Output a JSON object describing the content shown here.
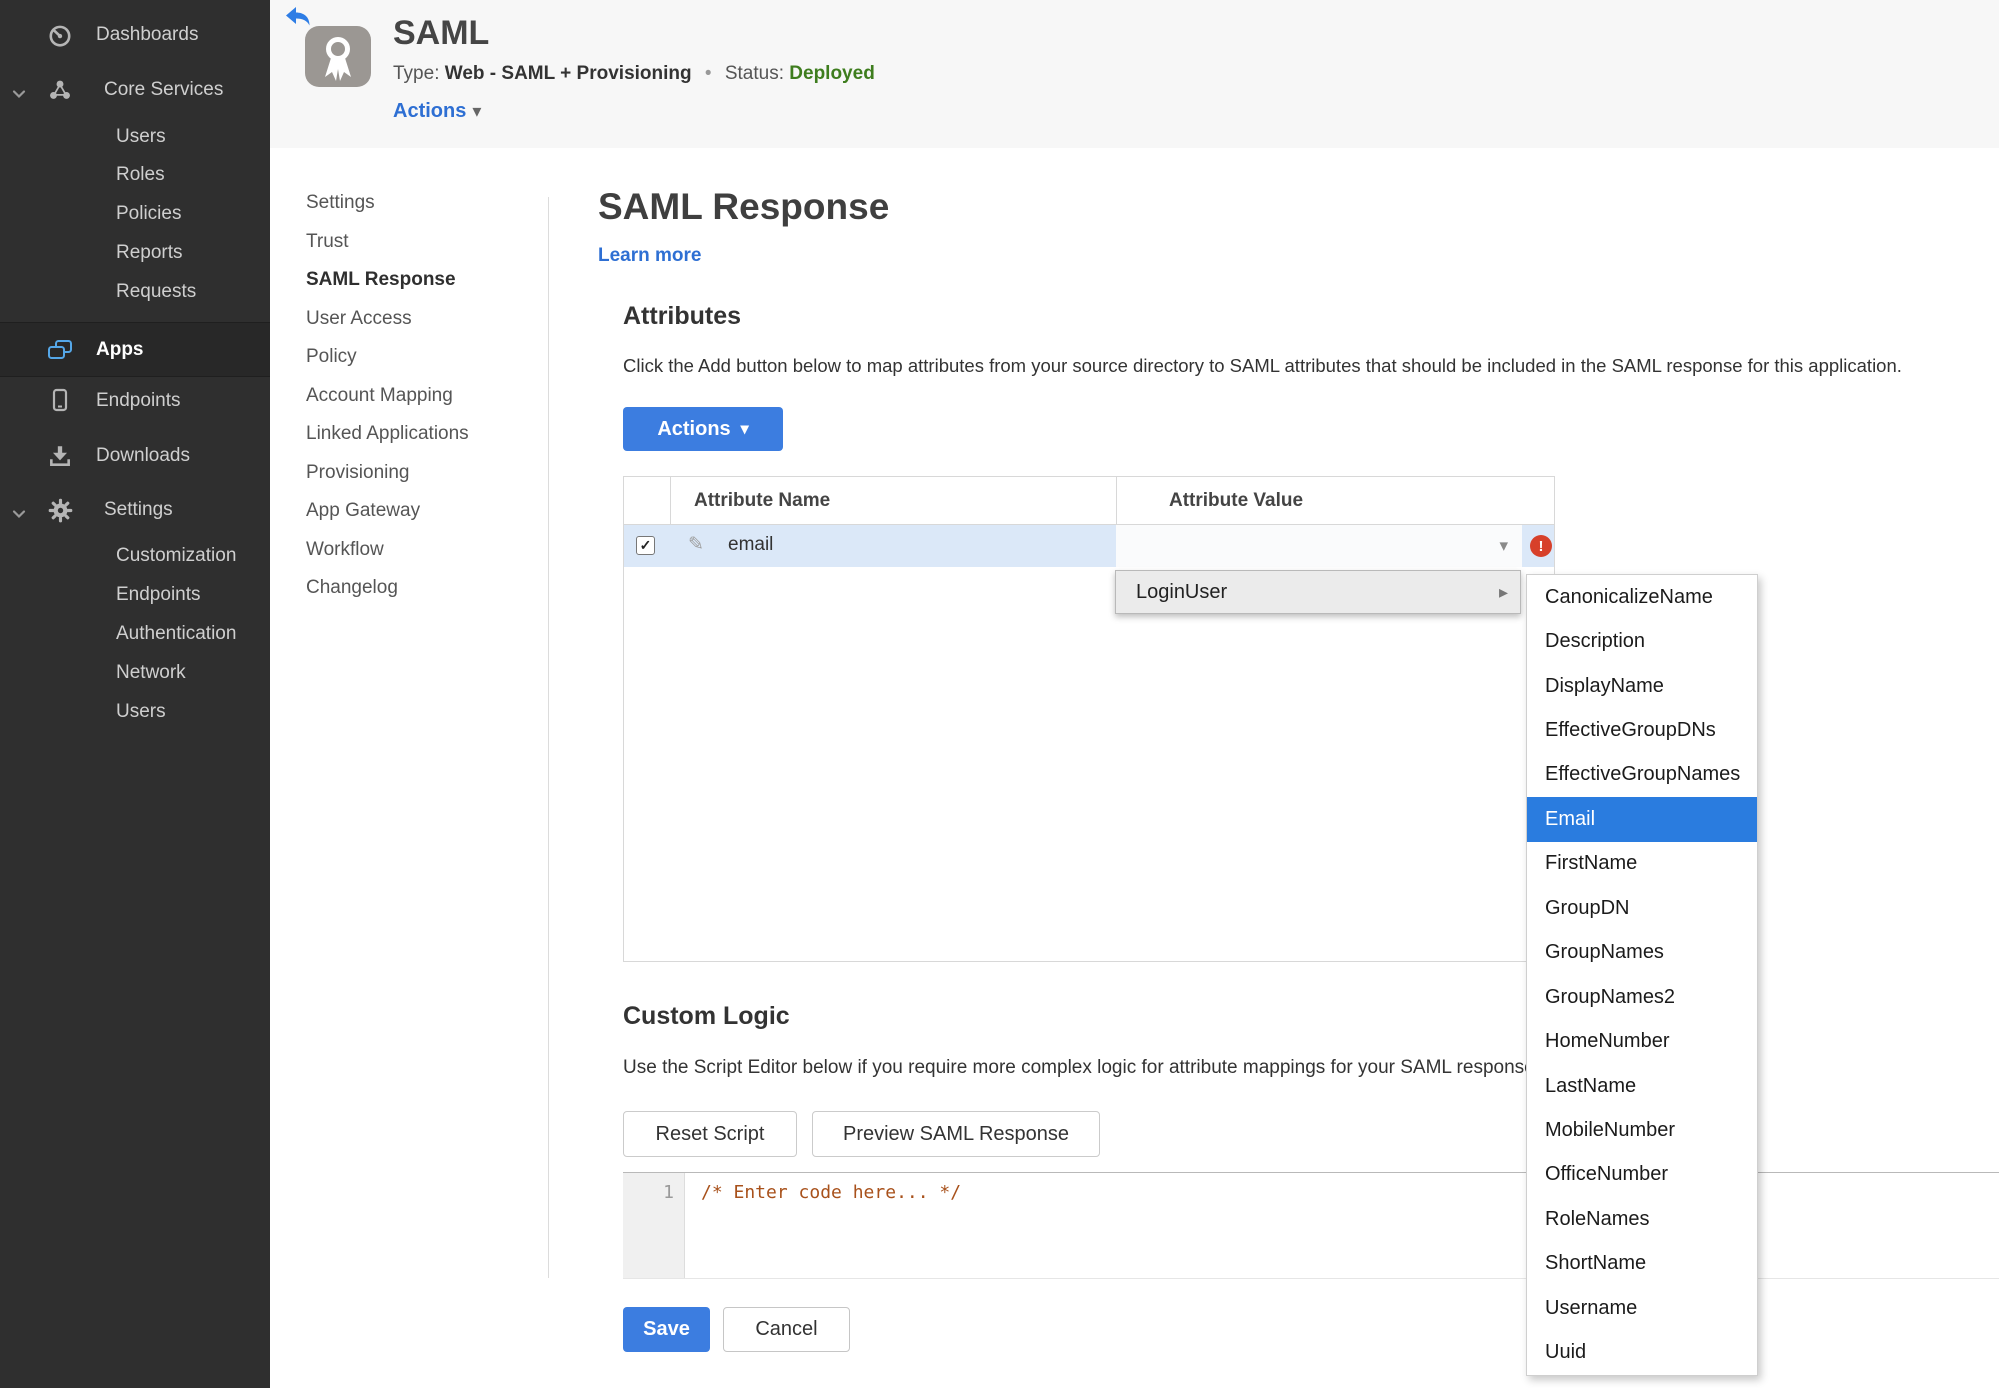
{
  "colors": {
    "accent_blue": "#3c7de0",
    "selection_blue": "#2a7cdf",
    "link_blue": "#2e6fd3",
    "status_green": "#3e7d1e",
    "error_red": "#d7402a",
    "sidebar_bg": "#2f2f2f",
    "header_band": "#f7f7f7",
    "row_highlight": "#dbe8f8"
  },
  "icons": {
    "caret_down": "▾",
    "submenu_arrow": "▸",
    "check": "✓",
    "pencil": "✎",
    "error_mark": "!",
    "bullet": "•"
  },
  "sidebar": {
    "items": [
      {
        "label": "Dashboards",
        "icon": "gauge-icon",
        "level": "top"
      },
      {
        "label": "Core Services",
        "icon": "cluster-icon",
        "level": "group",
        "expanded": true
      },
      {
        "label": "Users",
        "level": "sub"
      },
      {
        "label": "Roles",
        "level": "sub"
      },
      {
        "label": "Policies",
        "level": "sub"
      },
      {
        "label": "Reports",
        "level": "sub"
      },
      {
        "label": "Requests",
        "level": "sub"
      },
      {
        "label": "Apps",
        "icon": "apps-icon",
        "level": "top",
        "active": true
      },
      {
        "label": "Endpoints",
        "icon": "phone-icon",
        "level": "top"
      },
      {
        "label": "Downloads",
        "icon": "download-icon",
        "level": "top"
      },
      {
        "label": "Settings",
        "icon": "gear-icon",
        "level": "group",
        "expanded": true
      },
      {
        "label": "Customization",
        "level": "sub"
      },
      {
        "label": "Endpoints",
        "level": "sub"
      },
      {
        "label": "Authentication",
        "level": "sub"
      },
      {
        "label": "Network",
        "level": "sub"
      },
      {
        "label": "Users",
        "level": "sub"
      }
    ]
  },
  "header": {
    "app_title": "SAML",
    "type_label": "Type:",
    "type_value": "Web - SAML + Provisioning",
    "status_label": "Status:",
    "status_value": "Deployed",
    "actions_label": "Actions"
  },
  "subnav": {
    "items": [
      {
        "label": "Settings"
      },
      {
        "label": "Trust"
      },
      {
        "label": "SAML Response",
        "active": true
      },
      {
        "label": "User Access"
      },
      {
        "label": "Policy"
      },
      {
        "label": "Account Mapping"
      },
      {
        "label": "Linked Applications"
      },
      {
        "label": "Provisioning"
      },
      {
        "label": "App Gateway"
      },
      {
        "label": "Workflow"
      },
      {
        "label": "Changelog"
      }
    ]
  },
  "main": {
    "title": "SAML Response",
    "learn_more": "Learn more",
    "attributes": {
      "heading": "Attributes",
      "description": "Click the Add button below to map attributes from your source directory to SAML attributes that should be included in the SAML response for this application.",
      "actions_button": "Actions",
      "table": {
        "columns": [
          "Attribute Name",
          "Attribute Value"
        ],
        "rows": [
          {
            "name": "email",
            "checked": true,
            "value": "",
            "error": true
          }
        ]
      }
    },
    "value_menu": {
      "root": "LoginUser",
      "selected": "Email",
      "options": [
        "CanonicalizeName",
        "Description",
        "DisplayName",
        "EffectiveGroupDNs",
        "EffectiveGroupNames",
        "Email",
        "FirstName",
        "GroupDN",
        "GroupNames",
        "GroupNames2",
        "HomeNumber",
        "LastName",
        "MobileNumber",
        "OfficeNumber",
        "RoleNames",
        "ShortName",
        "Username",
        "Uuid"
      ]
    },
    "custom_logic": {
      "heading": "Custom Logic",
      "description": "Use the Script Editor below if you require more complex logic for attribute mappings for your SAML response.",
      "reset_button": "Reset Script",
      "preview_button": "Preview SAML Response",
      "editor": {
        "line_number": "1",
        "code": "/* Enter code here... */"
      }
    },
    "footer": {
      "save": "Save",
      "cancel": "Cancel"
    }
  }
}
